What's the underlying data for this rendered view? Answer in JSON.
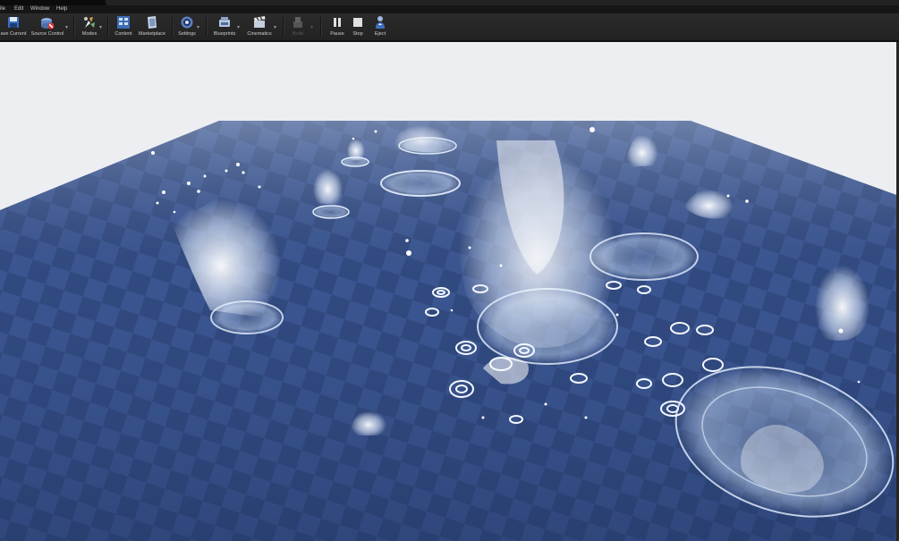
{
  "menu": {
    "file": "ile",
    "edit": "Edit",
    "window": "Window",
    "help": "Help"
  },
  "toolbar": {
    "save_current": "ave Current",
    "source_control": "Source Control",
    "modes": "Modes",
    "content": "Content",
    "marketplace": "Marketplace",
    "settings": "Settings",
    "blueprints": "Blueprints",
    "cinematics": "Cinematics",
    "build": "Build",
    "pause": "Pause",
    "stop": "Stop",
    "eject": "Eject"
  },
  "icons": {
    "save": "save-icon",
    "source_control": "source-control-icon",
    "modes": "modes-icon",
    "content": "content-browser-icon",
    "marketplace": "marketplace-icon",
    "settings": "settings-icon",
    "blueprints": "blueprints-icon",
    "cinematics": "cinematics-icon",
    "build": "build-icon",
    "pause": "pause-icon",
    "stop": "stop-icon",
    "eject": "eject-icon"
  },
  "colors": {
    "sky": "#eceef2",
    "water": "#2f4a82",
    "splash": "#ffffff",
    "toolbar": "#262626"
  }
}
